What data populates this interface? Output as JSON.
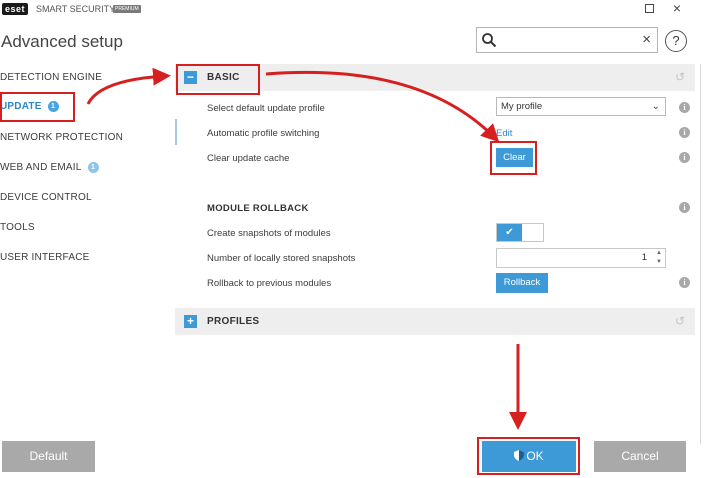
{
  "titlebar": {
    "logo": "eset",
    "product": "SMART SECURITY",
    "edition": "PREMIUM",
    "minimize_icon": "minimize-icon",
    "close_icon": "close-icon"
  },
  "header": {
    "title": "Advanced setup",
    "search": {
      "value": "",
      "placeholder": "",
      "icon": "search-icon",
      "clear": "×"
    },
    "help": "?"
  },
  "sidebar": {
    "items": [
      {
        "label": "DETECTION ENGINE",
        "active": false,
        "badge": ""
      },
      {
        "label": "UPDATE",
        "active": true,
        "badge": "1"
      },
      {
        "label": "NETWORK PROTECTION",
        "active": false,
        "badge": ""
      },
      {
        "label": "WEB AND EMAIL",
        "active": false,
        "badge": "1"
      },
      {
        "label": "DEVICE CONTROL",
        "active": false,
        "badge": ""
      },
      {
        "label": "TOOLS",
        "active": false,
        "badge": ""
      },
      {
        "label": "USER INTERFACE",
        "active": false,
        "badge": ""
      }
    ]
  },
  "main": {
    "basic": {
      "title": "BASIC",
      "toggle": "−",
      "rows": [
        {
          "label": "Select default update profile",
          "control": "My profile"
        },
        {
          "label": "Automatic profile switching",
          "control": "Edit"
        },
        {
          "label": "Clear update cache",
          "control": "Clear"
        }
      ]
    },
    "module_rollback": {
      "title": "MODULE ROLLBACK",
      "rows": [
        {
          "label": "Create snapshots of modules",
          "control": "✔"
        },
        {
          "label": "Number of locally stored snapshots",
          "control": "1"
        },
        {
          "label": "Rollback to previous modules",
          "control": "Rollback"
        }
      ]
    },
    "profiles": {
      "title": "PROFILES",
      "toggle": "+"
    },
    "info": "i",
    "reset": "↺"
  },
  "footer": {
    "default": "Default",
    "ok": "OK",
    "ok_icon": "shield-icon",
    "cancel": "Cancel"
  },
  "colors": {
    "accent": "#3d9ad6",
    "active_text": "#2d86c7",
    "annotation": "#d61f1f",
    "gray_button": "#a9a9a9"
  }
}
